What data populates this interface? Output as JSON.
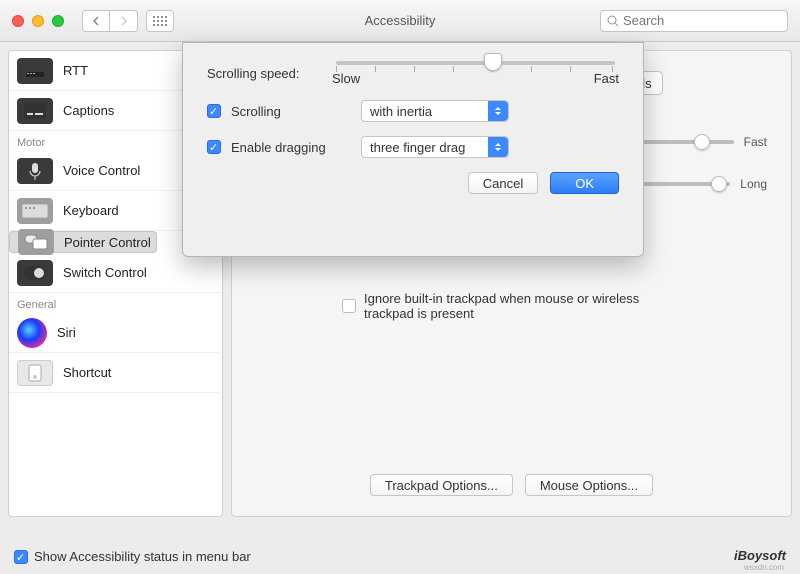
{
  "window": {
    "title": "Accessibility",
    "search_placeholder": "Search"
  },
  "sidebar": {
    "categories": [
      {
        "name": "",
        "items": [
          {
            "label": "RTT",
            "icon": "rtt-icon",
            "ico_class": "dark"
          },
          {
            "label": "Captions",
            "icon": "captions-icon",
            "ico_class": "dark"
          }
        ]
      },
      {
        "name": "Motor",
        "items": [
          {
            "label": "Voice Control",
            "icon": "voice-control-icon",
            "ico_class": "dark"
          },
          {
            "label": "Keyboard",
            "icon": "keyboard-icon",
            "ico_class": "grey"
          },
          {
            "label": "Pointer Control",
            "icon": "pointer-control-icon",
            "ico_class": "grey",
            "selected": true
          },
          {
            "label": "Switch Control",
            "icon": "switch-control-icon",
            "ico_class": "dark"
          }
        ]
      },
      {
        "name": "General",
        "items": [
          {
            "label": "Siri",
            "icon": "siri-icon",
            "ico_class": "siri"
          },
          {
            "label": "Shortcut",
            "icon": "shortcut-icon",
            "ico_class": "sc"
          }
        ]
      }
    ]
  },
  "main": {
    "tab_button": "l Methods",
    "slider1_end": "Fast",
    "slider2_end": "Long",
    "ignore_checkbox": "Ignore built-in trackpad when mouse or wireless trackpad is present",
    "trackpad_options": "Trackpad Options...",
    "mouse_options": "Mouse Options..."
  },
  "modal": {
    "scrolling_speed_label": "Scrolling speed:",
    "slow_label": "Slow",
    "fast_label": "Fast",
    "scrolling_checkbox": "Scrolling",
    "scrolling_select": "with inertia",
    "dragging_checkbox": "Enable dragging",
    "dragging_select": "three finger drag",
    "cancel": "Cancel",
    "ok": "OK"
  },
  "footer": {
    "status_checkbox": "Show Accessibility status in menu bar"
  },
  "watermark": "iBoysoft",
  "watermark_sub": "wsxdn.com"
}
